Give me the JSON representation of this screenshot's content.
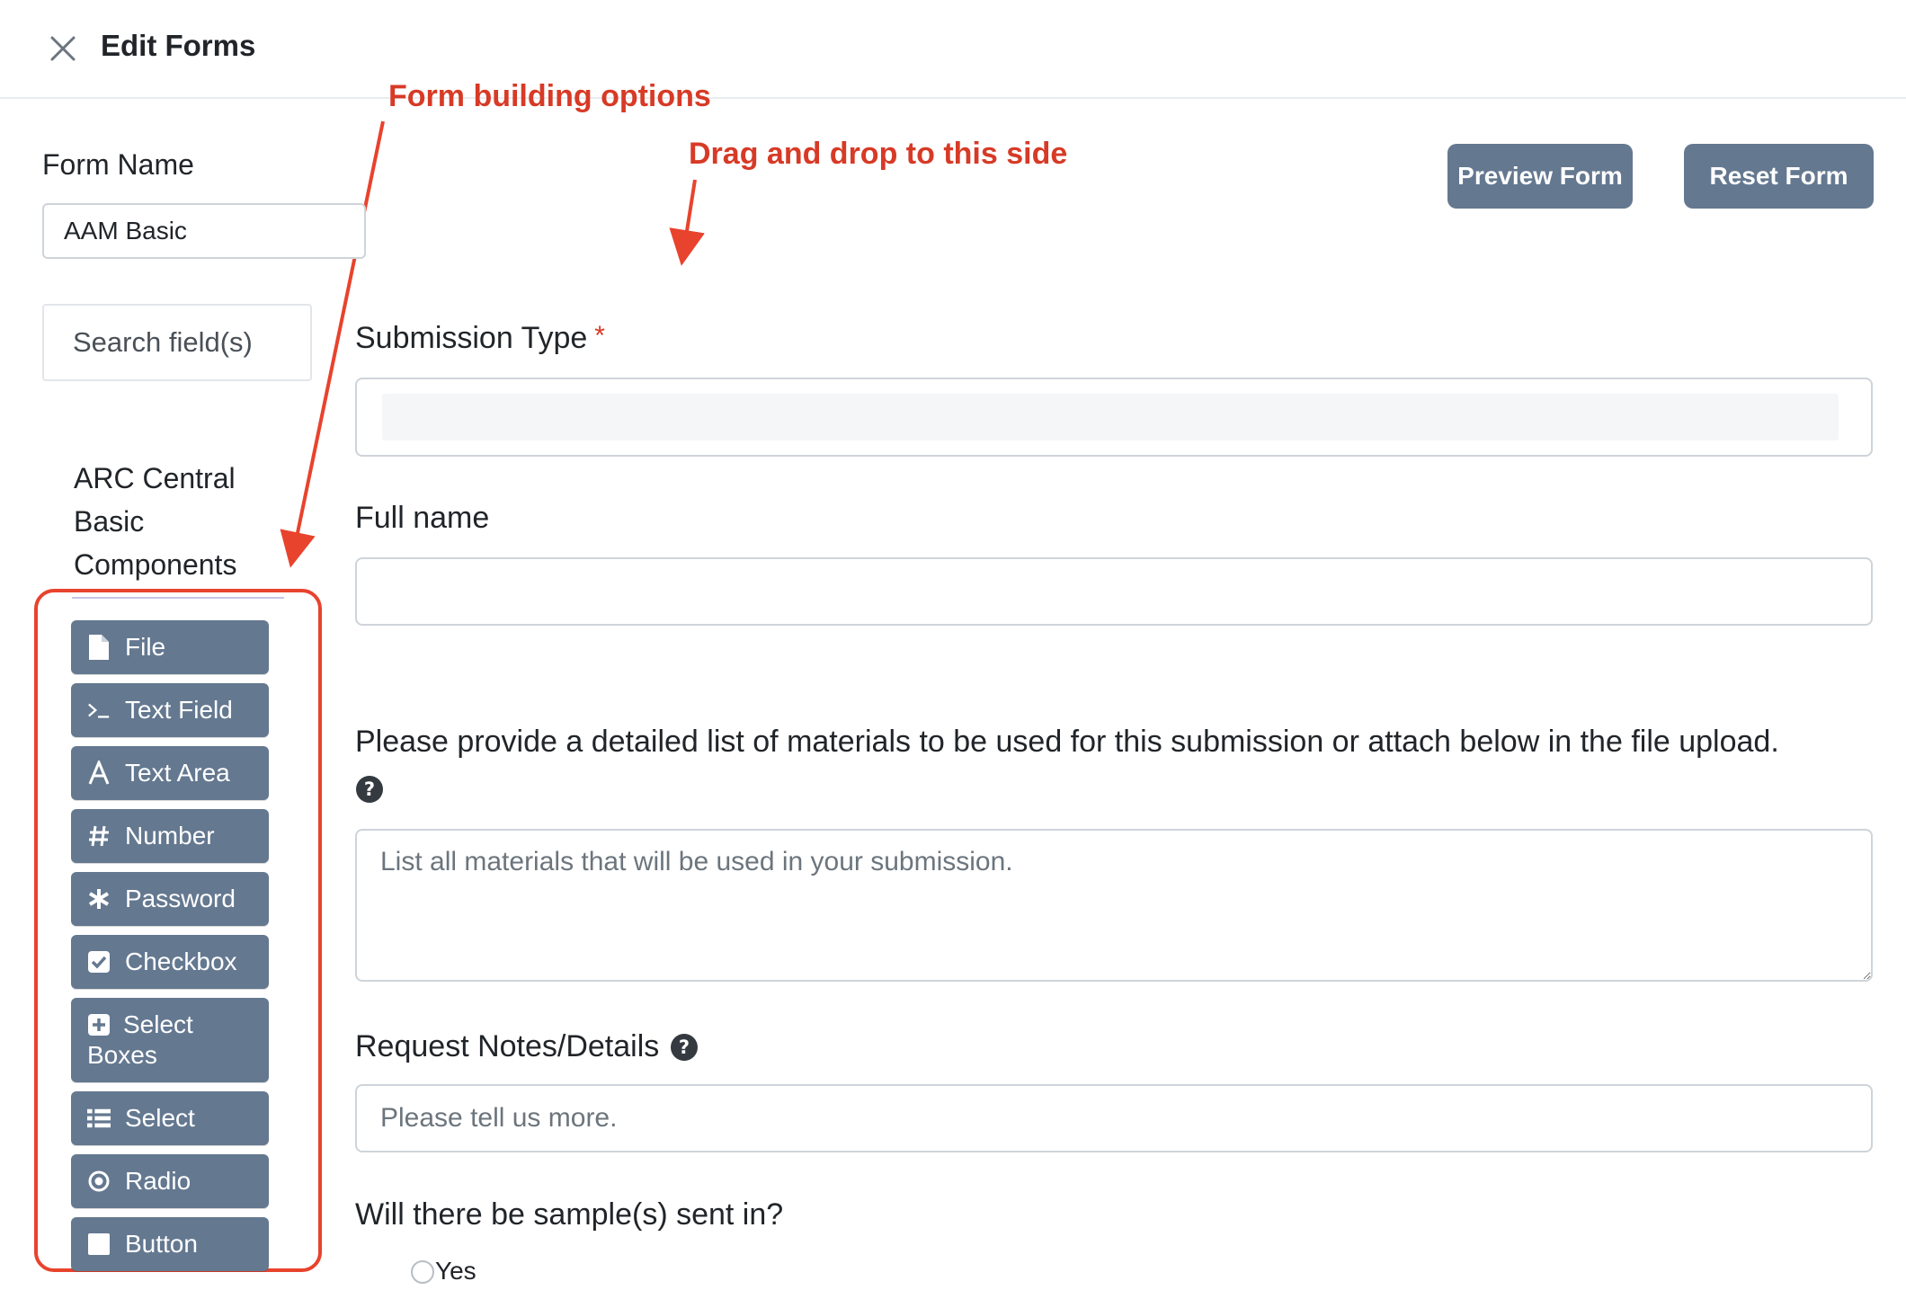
{
  "header": {
    "title": "Edit Forms"
  },
  "annotations": {
    "left": "Form building options",
    "right": "Drag and drop to this side"
  },
  "sidebar": {
    "form_name_label": "Form Name",
    "form_name_value": "AAM Basic",
    "search_placeholder": "Search field(s)",
    "group_title": "ARC Central Basic Components",
    "components": [
      {
        "label": "File",
        "icon": "file-icon"
      },
      {
        "label": "Text Field",
        "icon": "terminal-icon"
      },
      {
        "label": "Text Area",
        "icon": "font-icon"
      },
      {
        "label": "Number",
        "icon": "hashtag-icon"
      },
      {
        "label": "Password",
        "icon": "asterisk-icon"
      },
      {
        "label": "Checkbox",
        "icon": "check-square-icon"
      },
      {
        "label": "Select Boxes",
        "icon": "plus-square-icon"
      },
      {
        "label": "Select",
        "icon": "list-icon"
      },
      {
        "label": "Radio",
        "icon": "dot-circle-icon"
      },
      {
        "label": "Button",
        "icon": "stop-icon"
      }
    ]
  },
  "toolbar": {
    "preview_label": "Preview Form",
    "reset_label": "Reset Form"
  },
  "form": {
    "submission_type_label": "Submission Type",
    "required_mark": "*",
    "full_name_label": "Full name",
    "materials_label": "Please provide a detailed list of materials to be used for this submission or attach below in the file upload.",
    "materials_placeholder": "List all materials that will be used in your submission.",
    "notes_label": "Request Notes/Details",
    "notes_placeholder": "Please tell us more.",
    "samples_label": "Will there be sample(s) sent in?",
    "samples_options": [
      "Yes"
    ]
  },
  "colors": {
    "button_bg": "#647890",
    "annotation_red": "#d73a26",
    "highlight_border": "#e8432d"
  }
}
